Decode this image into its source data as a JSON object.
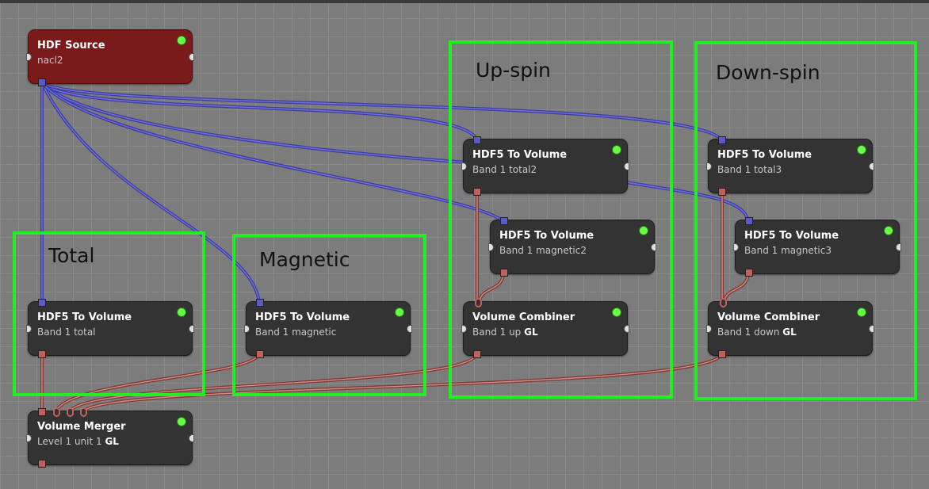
{
  "nodes": {
    "hdf_source": {
      "title": "HDF Source",
      "sub": "nacl2"
    },
    "total": {
      "title": "HDF5 To Volume",
      "sub": "Band  1 total"
    },
    "magnetic": {
      "title": "HDF5 To Volume",
      "sub": "Band  1 magnetic"
    },
    "up_total": {
      "title": "HDF5 To Volume",
      "sub": "Band  1 total2"
    },
    "up_magnetic": {
      "title": "HDF5 To Volume",
      "sub": "Band  1 magnetic2"
    },
    "up_combiner": {
      "title": "Volume Combiner",
      "sub": "Band  1 up ",
      "sub_bold": "GL"
    },
    "down_total": {
      "title": "HDF5 To Volume",
      "sub": "Band  1 total3"
    },
    "down_magnetic": {
      "title": "HDF5 To Volume",
      "sub": "Band  1 magnetic3"
    },
    "down_combiner": {
      "title": "Volume Combiner",
      "sub": "Band  1 down ",
      "sub_bold": "GL"
    },
    "merger": {
      "title": "Volume Merger",
      "sub": "Level 1  unit 1 ",
      "sub_bold": "GL"
    }
  },
  "groups": {
    "total": "Total",
    "magnetic": "Magnetic",
    "up_spin": "Up-spin",
    "down_spin": "Down-spin"
  },
  "colors": {
    "background": "#7c7c7c",
    "node": "#333333",
    "source_node": "#7a1a1a",
    "status_led": "#66ff44",
    "group_outline": "#22ee22",
    "volume_port": "#5a5ac8",
    "data_port": "#c0605a"
  }
}
